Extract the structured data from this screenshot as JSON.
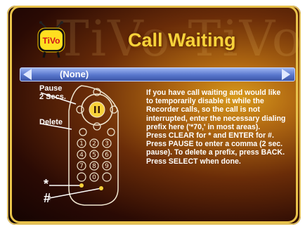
{
  "screen": {
    "title": "Call Waiting",
    "watermark": "TiVo TiVo"
  },
  "logo": {
    "text": "TiVo"
  },
  "option": {
    "value": "(None)"
  },
  "help": {
    "lines": [
      "If you have call waiting and would like",
      "to temporarily disable it while the",
      "Recorder calls, so the call is not",
      "interrupted, enter the necessary dialing",
      "prefix here ('*70,' in most areas).",
      "Press CLEAR for * and ENTER for #.",
      "Press PAUSE to enter a comma (2 sec.",
      "pause). To delete a prefix, press BACK.",
      "Press SELECT when done."
    ]
  },
  "remote": {
    "pause_label_1": "Pause",
    "pause_label_2": "2 Secs.",
    "delete_label": "Delete",
    "star_label": "*",
    "hash_label": "#",
    "keys": [
      "1",
      "2",
      "3",
      "4",
      "5",
      "6",
      "7",
      "8",
      "9",
      "0"
    ]
  },
  "colors": {
    "accent": "#f7d23a",
    "bar": "#5876cc"
  }
}
